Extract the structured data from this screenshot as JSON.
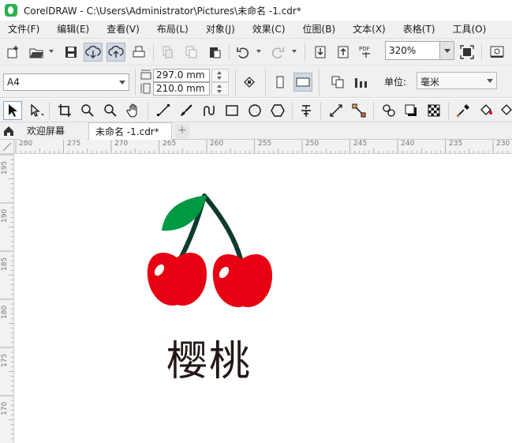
{
  "window": {
    "title": "CorelDRAW - C:\\Users\\Administrator\\Pictures\\未命名 -1.cdr*"
  },
  "menu": [
    {
      "label": "文件(F)"
    },
    {
      "label": "编辑(E)"
    },
    {
      "label": "查看(V)"
    },
    {
      "label": "布局(L)"
    },
    {
      "label": "对象(J)"
    },
    {
      "label": "效果(C)"
    },
    {
      "label": "位图(B)"
    },
    {
      "label": "文本(X)"
    },
    {
      "label": "表格(T)"
    },
    {
      "label": "工具(O)"
    }
  ],
  "toolbar": {
    "zoom_value": "320%",
    "pdf_label": "PDF"
  },
  "propertybar": {
    "page_size": "A4",
    "width": "297.0 mm",
    "height": "210.0 mm",
    "unit_label": "单位:",
    "unit_value": "毫米"
  },
  "tabs": {
    "welcome": "欢迎屏幕",
    "document": "未命名 -1.cdr*",
    "add": "+"
  },
  "ruler": {
    "horizontal": [
      "280",
      "275",
      "270",
      "265",
      "260",
      "255",
      "250",
      "245",
      "240",
      "235",
      "230"
    ],
    "vertical": [
      "195",
      "190",
      "185",
      "180",
      "175",
      "170"
    ]
  },
  "canvas": {
    "caption": "樱桃"
  },
  "colors": {
    "cherry_red": "#e60012",
    "leaf_green": "#009944",
    "stem_dark": "#0f3b2e",
    "caption_text": "#231815",
    "app_green": "#2bb24c"
  }
}
